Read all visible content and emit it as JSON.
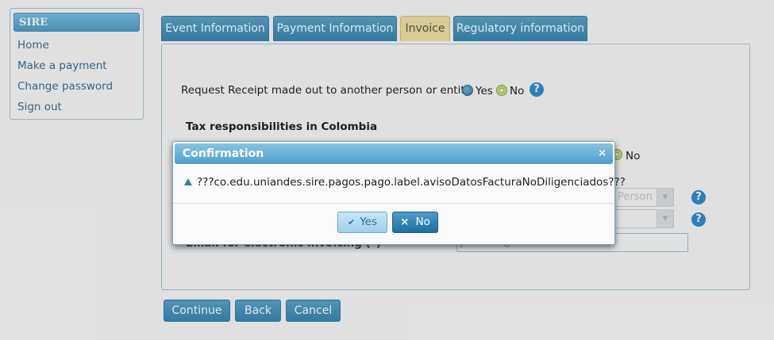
{
  "sidebar": {
    "title": "SIRE",
    "items": [
      {
        "label": "Home"
      },
      {
        "label": "Make a payment"
      },
      {
        "label": "Change password"
      },
      {
        "label": "Sign out"
      }
    ]
  },
  "tabs": [
    {
      "label": "Event Information",
      "active": false
    },
    {
      "label": "Payment Information",
      "active": false
    },
    {
      "label": "Invoice",
      "active": true
    },
    {
      "label": "Regulatory information",
      "active": false
    }
  ],
  "form": {
    "receipt_question": "Request Receipt made out to another person or entity",
    "yes_label": "Yes",
    "no_label": "No",
    "receipt_selected": "No",
    "tax_heading": "Tax responsibilities in Colombia",
    "tax_no_label": "No",
    "person_select_value": "Person",
    "email_label_partial": "Email for electronic invoicing (*)",
    "email_value": "johndoe@test.com",
    "help_symbol": "?"
  },
  "buttons": {
    "continue": "Continue",
    "back": "Back",
    "cancel": "Cancel"
  },
  "dialog": {
    "title": "Confirmation",
    "close_symbol": "×",
    "message": "???co.edu.uniandes.sire.pagos.pago.label.avisoDatosFacturaNoDiligenciados???",
    "yes_label": "Yes",
    "yes_icon": "✔",
    "no_label": "No",
    "no_icon": "×"
  }
}
